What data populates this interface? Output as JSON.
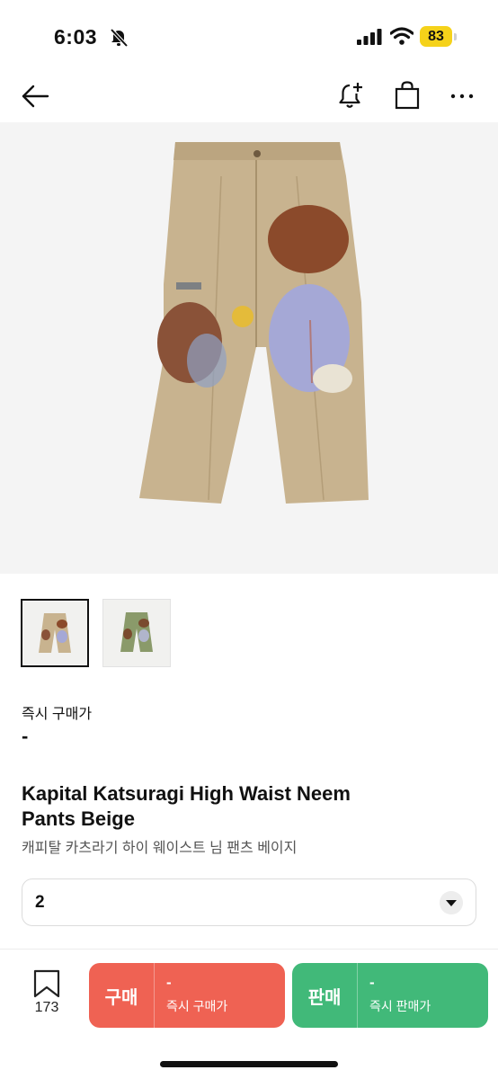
{
  "status_bar": {
    "time": "6:03",
    "battery": "83"
  },
  "product": {
    "thumbnails": [
      "beige",
      "green"
    ],
    "price_label": "즉시 구매가",
    "price_value": "-",
    "title": "Kapital Katsuragi High Waist Neem Pants Beige",
    "subtitle": "캐피탈 카츠라기 하이 웨이스트 님 팬츠 베이지"
  },
  "size_select": {
    "value": "2"
  },
  "bottom_bar": {
    "bookmark_count": "173",
    "buy": {
      "label": "구매",
      "price": "-",
      "sub": "즉시 구매가",
      "color": "#ef6253"
    },
    "sell": {
      "label": "판매",
      "price": "-",
      "sub": "즉시 판매가",
      "color": "#41b979"
    }
  }
}
